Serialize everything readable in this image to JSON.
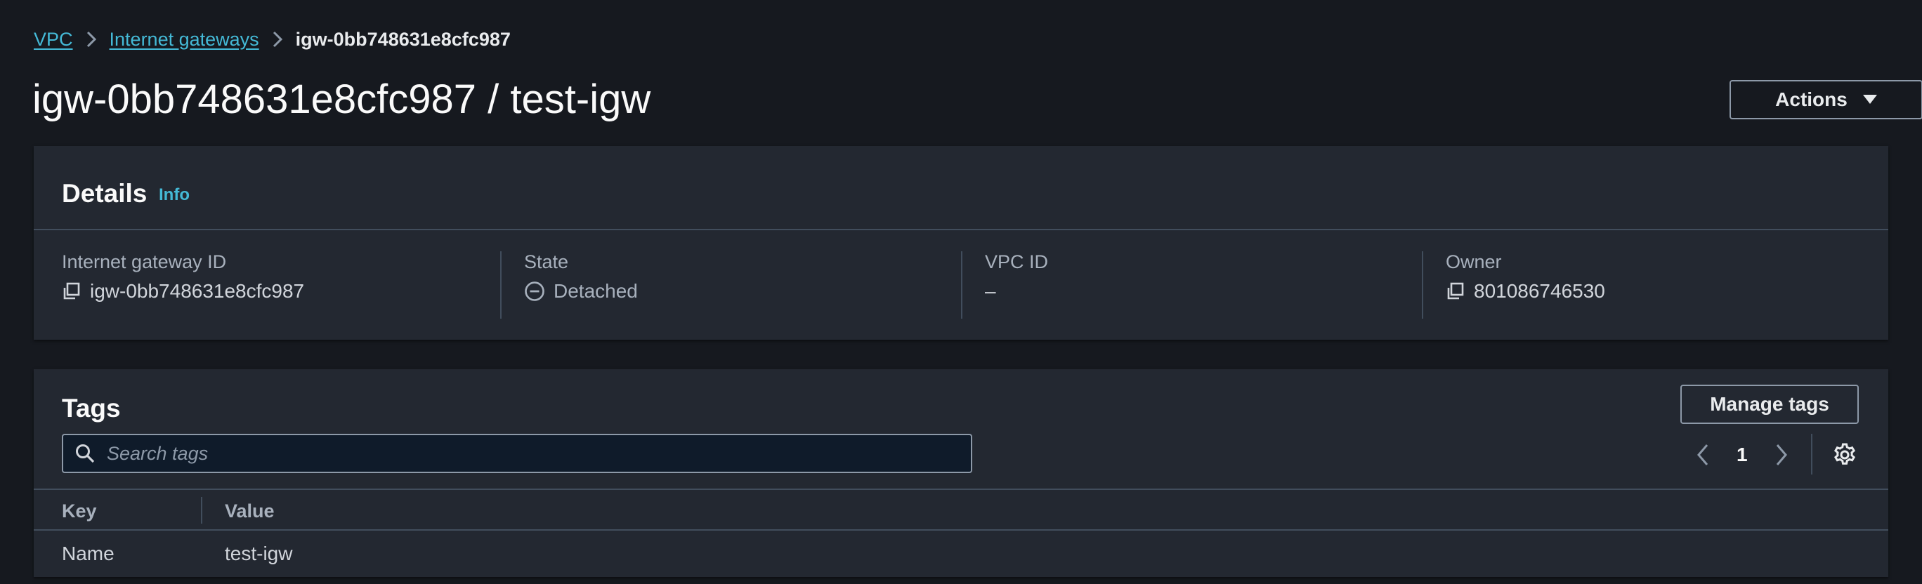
{
  "breadcrumb": {
    "items": [
      "VPC",
      "Internet gateways"
    ],
    "current": "igw-0bb748631e8cfc987"
  },
  "page": {
    "title": "igw-0bb748631e8cfc987 / test-igw",
    "actions_label": "Actions"
  },
  "details": {
    "heading": "Details",
    "info_label": "Info",
    "fields": [
      {
        "label": "Internet gateway ID",
        "value": "igw-0bb748631e8cfc987",
        "icon": "copy-icon"
      },
      {
        "label": "State",
        "value": "Detached",
        "icon": "detached-status-icon"
      },
      {
        "label": "VPC ID",
        "value": "–"
      },
      {
        "label": "Owner",
        "value": "801086746530",
        "icon": "copy-icon"
      }
    ]
  },
  "tags": {
    "heading": "Tags",
    "manage_label": "Manage tags",
    "search_placeholder": "Search tags",
    "current_page": "1",
    "columns": [
      "Key",
      "Value"
    ],
    "rows": [
      {
        "key": "Name",
        "value": "test-igw"
      }
    ]
  },
  "colors": {
    "background": "#16191f",
    "panel": "#232831",
    "link": "#44b9d6",
    "border": "#414d5c"
  }
}
